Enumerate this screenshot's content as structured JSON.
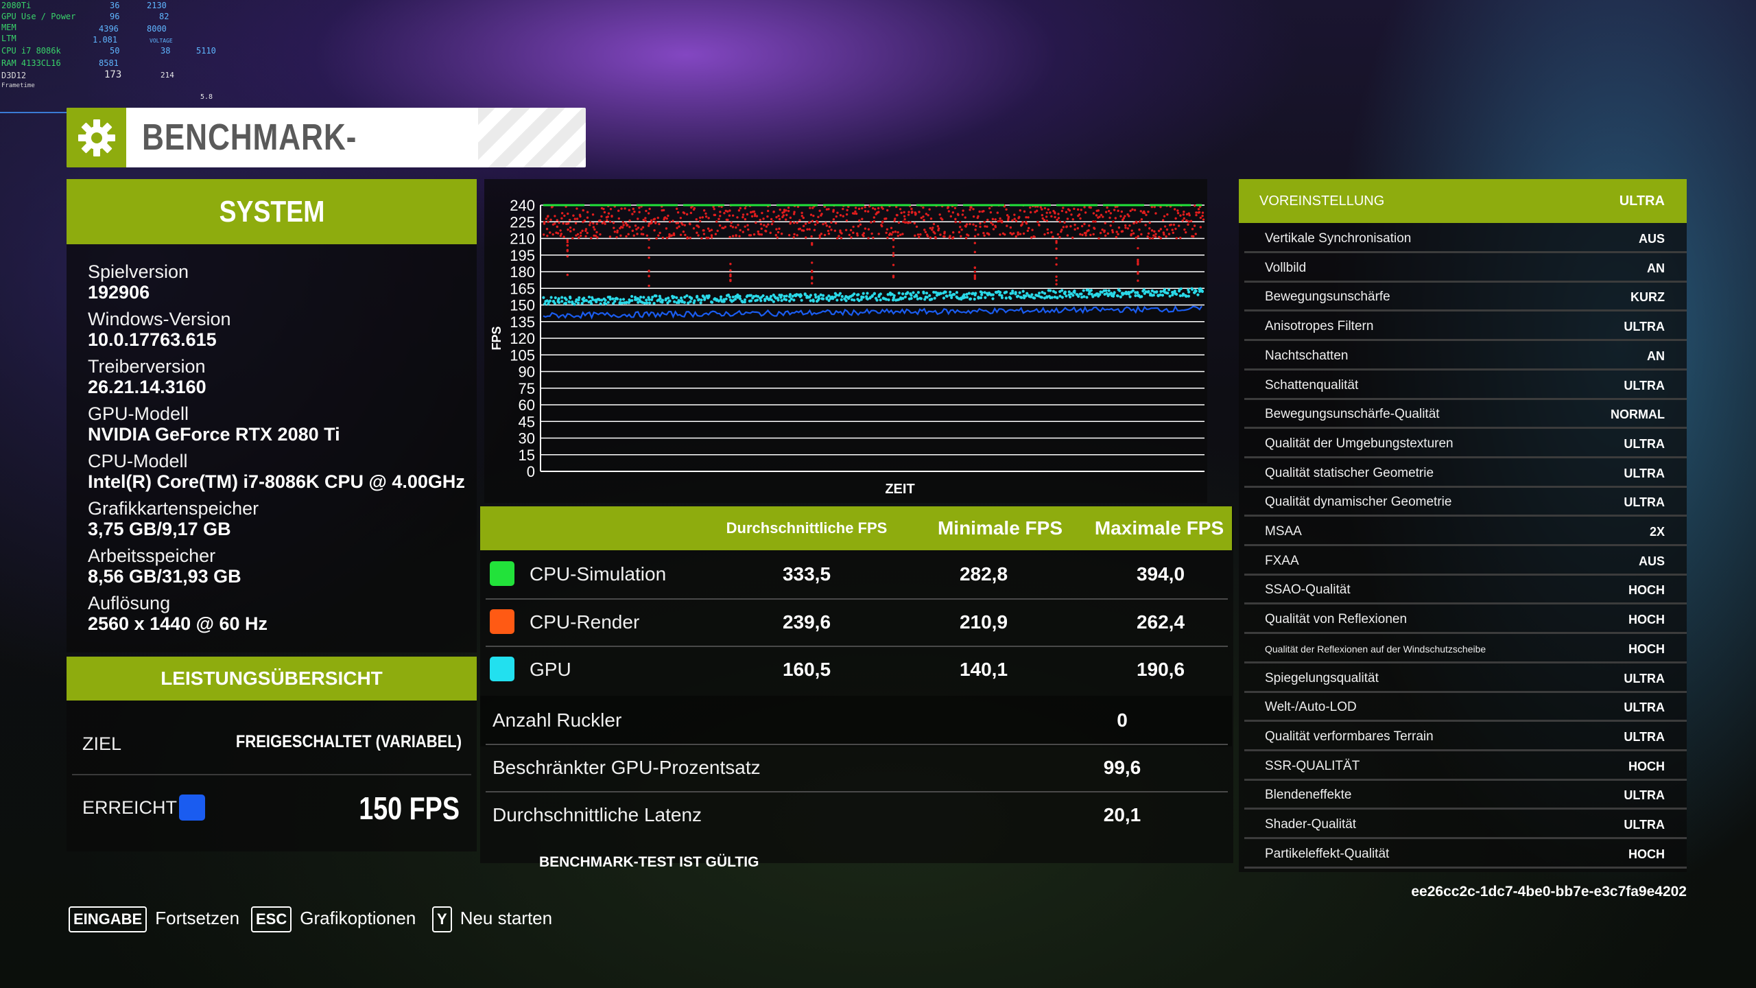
{
  "osd": {
    "gpu": "2080Ti",
    "gpu_use_label": "GPU Use / Power",
    "mem_label": "MEM",
    "ltm_label": "LTM",
    "cpu_label": "CPU i7 8086k",
    "ram_label": "RAM 4133CL16",
    "api_label": "D3D12",
    "frametime_label": "Frametime",
    "temp_gpu": "36",
    "gpu_use": "96",
    "mem": "4396",
    "voltage": "1.081",
    "cpu_temp": "50",
    "ram": "8581",
    "fps": "173",
    "clock": "2130",
    "power": "82",
    "mem_clock": "8000",
    "voltage_label": "VOLTAGE",
    "cpu_use": "38",
    "cpu_clock": "5110",
    "fps2": "214",
    "frametime": "5.8"
  },
  "title": "BENCHMARK-ERGEBNISSE",
  "system": {
    "header": "SYSTEM",
    "items": [
      {
        "label": "Spielversion",
        "value": "192906"
      },
      {
        "label": "Windows-Version",
        "value": "10.0.17763.615"
      },
      {
        "label": "Treiberversion",
        "value": "26.21.14.3160"
      },
      {
        "label": "GPU-Modell",
        "value": "NVIDIA GeForce RTX 2080 Ti"
      },
      {
        "label": "CPU-Modell",
        "value": "Intel(R) Core(TM) i7-8086K CPU @ 4.00GHz"
      },
      {
        "label": "Grafikkartenspeicher",
        "value": "3,75 GB/9,17 GB"
      },
      {
        "label": "Arbeitsspeicher",
        "value": "8,56 GB/31,93 GB"
      },
      {
        "label": "Auflösung",
        "value": "2560 x 1440 @ 60 Hz"
      }
    ]
  },
  "performance": {
    "header": "LEISTUNGSÜBERSICHT",
    "target_label": "ZIEL",
    "target_value": "FREIGESCHALTET (VARIABEL)",
    "achieved_label": "ERREICHT",
    "achieved_value": "150 FPS",
    "achieved_color": "#1a5cf0"
  },
  "chart_data": {
    "type": "scatter",
    "ylabel": "FPS",
    "xlabel": "ZEIT",
    "ylim": [
      0,
      240
    ],
    "yticks": [
      "240",
      "225",
      "210",
      "195",
      "180",
      "165",
      "150",
      "135",
      "120",
      "105",
      "90",
      "75",
      "60",
      "45",
      "30",
      "15",
      "0"
    ],
    "grid": true,
    "series": [
      {
        "name": "CPU-Simulation",
        "color": "#22e23a",
        "band": [
          238,
          240
        ]
      },
      {
        "name": "CPU-Render",
        "color": "#e01d1d",
        "band": [
          210,
          240
        ]
      },
      {
        "name": "GPU",
        "color": "#2ad9e8",
        "band": [
          150,
          165
        ]
      },
      {
        "color": "#1a5cf0",
        "band": [
          140,
          150
        ]
      }
    ]
  },
  "results": {
    "col_avg": "Durchschnittliche FPS",
    "col_min": "Minimale FPS",
    "col_max": "Maximale FPS",
    "rows": [
      {
        "label": "CPU-Simulation",
        "color": "#22e23a",
        "avg": "333,5",
        "min": "282,8",
        "max": "394,0"
      },
      {
        "label": "CPU-Render",
        "color": "#ff5a14",
        "avg": "239,6",
        "min": "210,9",
        "max": "262,4"
      },
      {
        "label": "GPU",
        "color": "#22e0ef",
        "avg": "160,5",
        "min": "140,1",
        "max": "190,6"
      }
    ],
    "stats": [
      {
        "label": "Anzahl Ruckler",
        "value": "0"
      },
      {
        "label": "Beschränkter GPU-Prozentsatz",
        "value": "99,6"
      },
      {
        "label": "Durchschnittliche Latenz",
        "value": "20,1"
      }
    ],
    "valid_text": "BENCHMARK-TEST IST GÜLTIG"
  },
  "settings": {
    "header_label": "VOREINSTELLUNG",
    "header_value": "ULTRA",
    "rows": [
      {
        "label": "Vertikale Synchronisation",
        "value": "AUS"
      },
      {
        "label": "Vollbild",
        "value": "AN"
      },
      {
        "label": "Bewegungsunschärfe",
        "value": "KURZ"
      },
      {
        "label": "Anisotropes Filtern",
        "value": "ULTRA"
      },
      {
        "label": "Nachtschatten",
        "value": "AN"
      },
      {
        "label": "Schattenqualität",
        "value": "ULTRA"
      },
      {
        "label": "Bewegungsunschärfe-Qualität",
        "value": "NORMAL"
      },
      {
        "label": "Qualität der Umgebungstexturen",
        "value": "ULTRA"
      },
      {
        "label": "Qualität statischer Geometrie",
        "value": "ULTRA"
      },
      {
        "label": "Qualität dynamischer Geometrie",
        "value": "ULTRA"
      },
      {
        "label": "MSAA",
        "value": "2X"
      },
      {
        "label": "FXAA",
        "value": "AUS"
      },
      {
        "label": "SSAO-Qualität",
        "value": "HOCH"
      },
      {
        "label": "Qualität von Reflexionen",
        "value": "HOCH"
      },
      {
        "label": "Qualität der Reflexionen auf der Windschutzscheibe",
        "value": "HOCH"
      },
      {
        "label": "Spiegelungsqualität",
        "value": "ULTRA"
      },
      {
        "label": "Welt-/Auto-LOD",
        "value": "ULTRA"
      },
      {
        "label": "Qualität verformbares Terrain",
        "value": "ULTRA"
      },
      {
        "label": "SSR-QUALITÄT",
        "value": "HOCH"
      },
      {
        "label": "Blendeneffekte",
        "value": "ULTRA"
      },
      {
        "label": "Shader-Qualität",
        "value": "ULTRA"
      },
      {
        "label": "Partikeleffekt-Qualität",
        "value": "HOCH"
      }
    ]
  },
  "guid": "ee26cc2c-1dc7-4be0-bb7e-e3c7fa9e4202",
  "prompts": [
    {
      "key": "EINGABE",
      "label": "Fortsetzen"
    },
    {
      "key": "ESC",
      "label": "Grafikoptionen"
    },
    {
      "key": "Y",
      "label": "Neu starten"
    }
  ]
}
